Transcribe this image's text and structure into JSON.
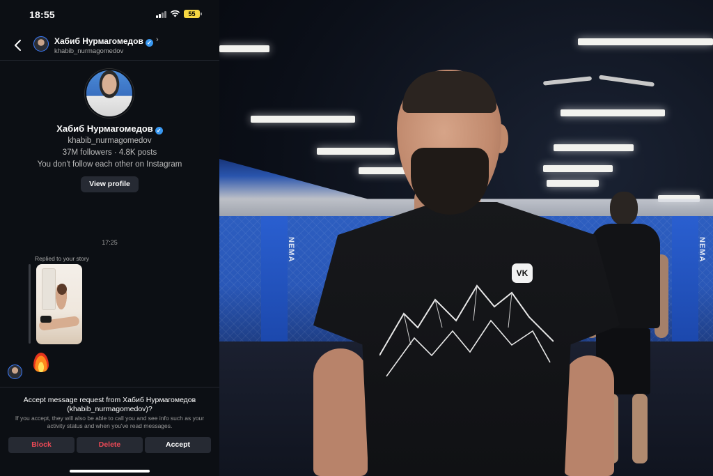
{
  "status_bar": {
    "time": "18:55",
    "battery": "55"
  },
  "header": {
    "name": "Хабиб Нурмагомедов",
    "username": "khabib_nurmagomedov"
  },
  "profile": {
    "name": "Хабиб Нурмагомедов",
    "username": "khabib_nurmagomedov",
    "stats": "37M followers · 4.8K posts",
    "follow_note": "You don't follow each other on Instagram",
    "view_profile_label": "View profile"
  },
  "messages": {
    "timestamp": "17:25",
    "replied_label": "Replied to your story",
    "reaction": "🔥"
  },
  "request": {
    "title_line1": "Accept message request from Хабиб Нурмагомедов",
    "title_line2": "(khabib_nurmagomedov)?",
    "info": "If you accept, they will also be able to call you and see info such as your activity status and when you've read messages.",
    "block_label": "Block",
    "delete_label": "Delete",
    "accept_label": "Accept"
  },
  "photo": {
    "shirt_logo": "VK",
    "pad_text": "NEMA"
  },
  "colors": {
    "background": "#0c0f14",
    "button": "#262a33",
    "destructive": "#ed4956",
    "verified": "#3897f0",
    "battery": "#f5d742",
    "cage_blue": "#2a58b8"
  },
  "icons": [
    "back-chevron-icon",
    "verified-badge-icon",
    "chevron-right-icon",
    "signal-icon",
    "wifi-icon",
    "battery-icon",
    "fire-emoji"
  ]
}
